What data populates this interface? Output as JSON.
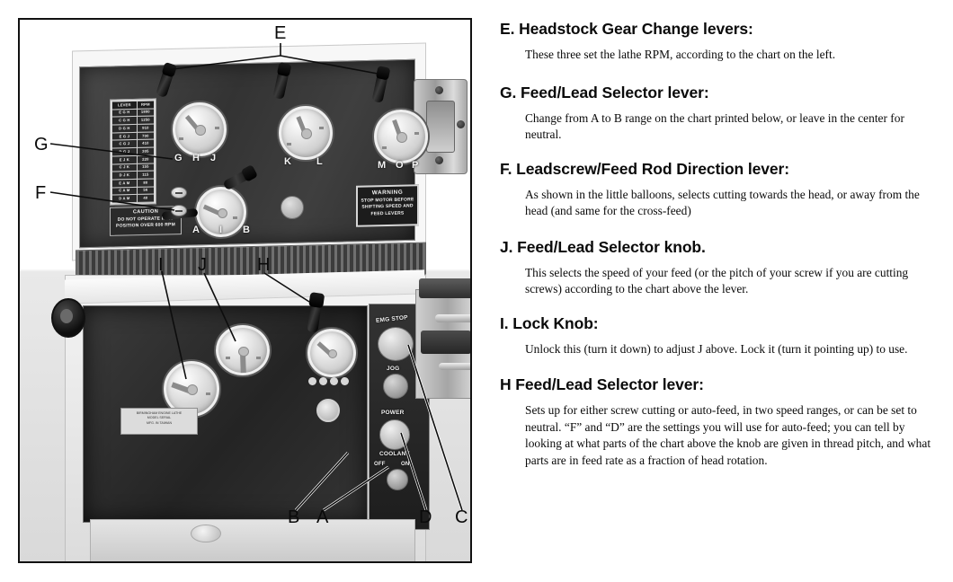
{
  "figure": {
    "caption_letters_on_photo": [
      "E",
      "G",
      "F",
      "I",
      "J",
      "H",
      "B",
      "A",
      "D",
      "C"
    ],
    "labels": {
      "E": "E",
      "G": "G",
      "F": "F",
      "I": "I",
      "J": "J",
      "H": "H",
      "B": "B",
      "A": "A",
      "D": "D",
      "C": "C"
    },
    "headstock": {
      "rpm_plate": {
        "headers": [
          "LEVER",
          "RPM"
        ],
        "rows": [
          [
            "E G H",
            "1800"
          ],
          [
            "C G H",
            "1250"
          ],
          [
            "D G H",
            "  910"
          ],
          [
            "E G J",
            "  700"
          ],
          [
            "C G J",
            "  410"
          ],
          [
            "D G J",
            "  305"
          ],
          [
            "E J K",
            "  220"
          ],
          [
            "C J K",
            "  155"
          ],
          [
            "D J K",
            "  115"
          ],
          [
            "E A M",
            "   80"
          ],
          [
            "C A M",
            "   56"
          ],
          [
            "D A M",
            "   40"
          ]
        ]
      },
      "caution_plate": {
        "title": "CAUTION",
        "line1": "DO NOT OPERATE IN 'A'",
        "line2": "POSITION OVER 600 RPM"
      },
      "warning_plate": {
        "title": "WARNING",
        "line1": "STOP MOTOR BEFORE",
        "line2": "SHIFTING SPEED AND",
        "line3": "FEED LEVERS"
      },
      "dial_letters": {
        "left_dial": [
          "G",
          "H",
          "J"
        ],
        "mid_dial": [
          "K",
          "L"
        ],
        "right_dial": [
          "M",
          "O",
          "P"
        ],
        "feed_dial": [
          "A",
          "I",
          "B"
        ]
      }
    },
    "apron": {
      "spec_plate_lines": [
        "BIRMINGHAM ENGINE LATHE",
        "MODEL  SERIAL",
        "MFG. IN TAIWAN"
      ],
      "button_panel": {
        "emg_stop": "EMG STOP",
        "jog": "JOG",
        "power": "POWER",
        "coolant": "COOLANT",
        "coolant_off": "OFF",
        "coolant_on": "ON"
      }
    }
  },
  "legend": {
    "entries": [
      {
        "heading": "E. Headstock Gear Change levers:",
        "body": "These three set the lathe RPM, according to the chart on the left."
      },
      {
        "heading": "G. Feed/Lead Selector lever:",
        "body": "Change from A to B range on the chart printed below, or leave in the center for neutral."
      },
      {
        "heading": "F. Leadscrew/Feed Rod Direction lever:",
        "body": "As shown in the little balloons, selects cutting towards the head, or away from the head (and same for the cross-feed)"
      },
      {
        "heading": "J. Feed/Lead Selector knob.",
        "body": "This selects the speed of your feed (or the pitch of your screw if you are cutting screws) according to the chart above the lever."
      },
      {
        "heading": "I. Lock Knob:",
        "body": "Unlock this (turn it down) to adjust J above. Lock it (turn it pointing up) to use."
      },
      {
        "heading": "H Feed/Lead Selector lever:",
        "body": "Sets up for either screw cutting or auto-feed, in two speed ranges, or can be set to neutral. “F” and “D” are the settings you will use for auto-feed; you can tell by looking at what parts of the chart above the knob are given in thread pitch, and what parts are in feed rate as a fraction of head rotation."
      }
    ]
  },
  "colors": {
    "page_background": "#ffffff",
    "frame_border": "#111111",
    "text": "#0a0a0a",
    "machine_dark_panel": "#2b2b2b",
    "machine_light_casing": "#f4f4f4"
  }
}
